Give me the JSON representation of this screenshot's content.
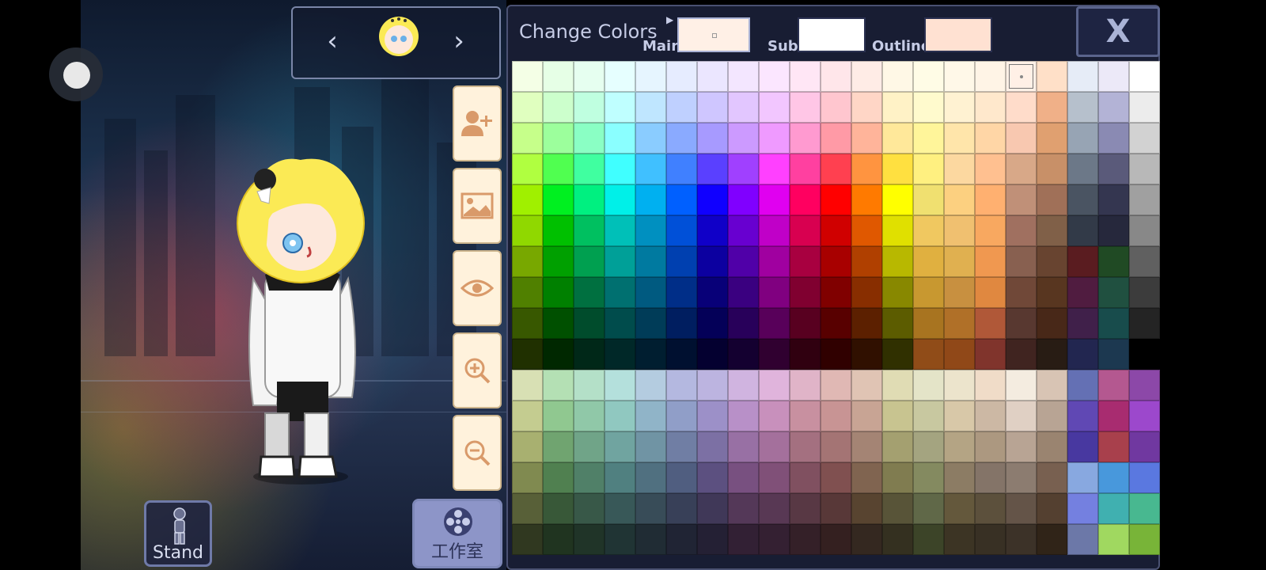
{
  "screen": {
    "accent": "#8d95c8"
  },
  "left_panel": {
    "stand_label": "Stand",
    "studio_label": "工作室",
    "side_buttons": [
      {
        "icon": "add-person-icon"
      },
      {
        "icon": "background-image-icon"
      },
      {
        "icon": "eye-icon"
      },
      {
        "icon": "zoom-in-icon"
      },
      {
        "icon": "zoom-out-icon"
      }
    ],
    "nav": {
      "prev": "‹",
      "next": "›"
    }
  },
  "color_panel": {
    "title": "Change Colors",
    "main_label": "Main",
    "sub_label": "Sub",
    "outline_label": "Outline",
    "main_color": "#fff0e6",
    "sub_color": "#ffffff",
    "outline_color": "#ffe1d2",
    "close_label": "X",
    "selected_cell": [
      0,
      16
    ],
    "palette": [
      [
        "#f4ffe6",
        "#e6ffe6",
        "#e6fff0",
        "#e6ffff",
        "#e6f5ff",
        "#e6ecff",
        "#ebe6ff",
        "#f3e6ff",
        "#fbe6ff",
        "#ffe6f5",
        "#ffe6ea",
        "#ffece6",
        "#fff8e6",
        "#fffce6",
        "#fff8e8",
        "#fff4e6",
        "#fff0e6",
        "#ffe0c8",
        "#e6ecf7",
        "#ece9f8",
        "#ffffff"
      ],
      [
        "#e0ffbf",
        "#ccffcc",
        "#bfffe0",
        "#bfffff",
        "#bfe6ff",
        "#bfd0ff",
        "#cfc6ff",
        "#e2c6ff",
        "#f2c6ff",
        "#ffc6e6",
        "#ffc6cf",
        "#ffd6c6",
        "#fff2c6",
        "#fffacd",
        "#fff2d2",
        "#ffe8cc",
        "#ffdcca",
        "#f0b088",
        "#b6c0cc",
        "#b3b3d6",
        "#ececec"
      ],
      [
        "#c6ff8a",
        "#9cff9c",
        "#8affc4",
        "#8affff",
        "#8accff",
        "#8aaaff",
        "#a79aff",
        "#cc9aff",
        "#ef9aff",
        "#ff9ad0",
        "#ff9aa6",
        "#ffb49a",
        "#ffe89a",
        "#fff59a",
        "#ffe5aa",
        "#ffd6a6",
        "#f8c8b0",
        "#e0a070",
        "#97a4b4",
        "#8a8ab3",
        "#d2d2d2"
      ],
      [
        "#b0ff40",
        "#50ff50",
        "#40ffa0",
        "#40ffff",
        "#40c0ff",
        "#4080ff",
        "#5a40ff",
        "#a040ff",
        "#ff40ff",
        "#ff40a0",
        "#ff4050",
        "#ff9440",
        "#ffe040",
        "#fff080",
        "#fcd8a0",
        "#ffc090",
        "#d8a888",
        "#c89068",
        "#6c7888",
        "#5a5a7a",
        "#b8b8b8"
      ],
      [
        "#a0f000",
        "#00f020",
        "#00f080",
        "#00f0e8",
        "#00b0f0",
        "#0060ff",
        "#1000ff",
        "#8000ff",
        "#e000f0",
        "#ff0060",
        "#ff0000",
        "#ff7a00",
        "#ffff00",
        "#f0e070",
        "#fcd080",
        "#ffb070",
        "#c09078",
        "#a07058",
        "#4a5462",
        "#343650",
        "#a0a0a0"
      ],
      [
        "#90d800",
        "#00c000",
        "#00c060",
        "#00c0b8",
        "#0090c0",
        "#0050d8",
        "#1000c8",
        "#6800d0",
        "#c000c8",
        "#d80050",
        "#d00000",
        "#e05800",
        "#e0e000",
        "#f0c860",
        "#f0c070",
        "#f8a860",
        "#a07060",
        "#806048",
        "#323a48",
        "#26283c",
        "#888888"
      ],
      [
        "#78a800",
        "#00a000",
        "#00a050",
        "#00a098",
        "#007aa0",
        "#0040b0",
        "#0c00a0",
        "#5000a8",
        "#a000a0",
        "#a80040",
        "#a80000",
        "#b04000",
        "#b8b800",
        "#e0b040",
        "#e0b050",
        "#f09850",
        "#886050",
        "#684430",
        "#5a1c20",
        "#204a24",
        "#606060"
      ],
      [
        "#508000",
        "#008000",
        "#007040",
        "#007070",
        "#005a80",
        "#002e88",
        "#080078",
        "#3a0080",
        "#800080",
        "#800030",
        "#800000",
        "#882e00",
        "#888800",
        "#c89830",
        "#c89040",
        "#e08840",
        "#704838",
        "#583620",
        "#501c40",
        "#205040",
        "#3c3c3c"
      ],
      [
        "#385800",
        "#005000",
        "#004c2c",
        "#004c4c",
        "#003c58",
        "#001e60",
        "#040058",
        "#28005a",
        "#58005a",
        "#580020",
        "#580000",
        "#5c2000",
        "#5c5c00",
        "#a87420",
        "#b07028",
        "#b05838",
        "#583830",
        "#482818",
        "#40204a",
        "#184c4c",
        "#242424"
      ],
      [
        "#203000",
        "#002800",
        "#002818",
        "#002828",
        "#001e30",
        "#001030",
        "#040030",
        "#140030",
        "#300030",
        "#300010",
        "#300000",
        "#301000",
        "#303000",
        "#904c18",
        "#904818",
        "#80342c",
        "#402420",
        "#281c14",
        "#222650",
        "#1c3850",
        "#000000"
      ],
      [
        "#d8e0b4",
        "#b4e0b4",
        "#b4e0c8",
        "#b4e0dc",
        "#b4cce0",
        "#b4b8e0",
        "#bcb4e0",
        "#d0b4e0",
        "#e0b4dc",
        "#e0b4c8",
        "#e0b8b4",
        "#e0c4b4",
        "#e0dcb4",
        "#e4e4c8",
        "#ece4cc",
        "#f0dcc8",
        "#f4ece0",
        "#d8c4b4",
        "#6470b4",
        "#b45890",
        "#8c48a8"
      ],
      [
        "#c4cc90",
        "#90c890",
        "#90c8a8",
        "#90c8c0",
        "#90b4c8",
        "#909ec8",
        "#9c90c8",
        "#b890c8",
        "#c890bc",
        "#c890a0",
        "#c89494",
        "#c8a494",
        "#c8c490",
        "#c8c8a0",
        "#d8c8a8",
        "#ccb8a4",
        "#e0d0c4",
        "#b8a494",
        "#6048b4",
        "#a82c70",
        "#9c48cc"
      ],
      [
        "#a8b070",
        "#70a470",
        "#70a488",
        "#70a4a0",
        "#7094a4",
        "#707ea4",
        "#7c70a4",
        "#9870a4",
        "#a4709c",
        "#a47080",
        "#a47474",
        "#a48474",
        "#a4a070",
        "#a4a480",
        "#b4a484",
        "#ac9880",
        "#b8a494",
        "#9a8470",
        "#4838a0",
        "#a8404c",
        "#7038a0"
      ],
      [
        "#808a50",
        "#508050",
        "#508068",
        "#508080",
        "#507080",
        "#505e80",
        "#5c5080",
        "#785080",
        "#805078",
        "#805060",
        "#805050",
        "#806450",
        "#807c50",
        "#848a60",
        "#8c7c64",
        "#847468",
        "#8c7c70",
        "#786050",
        "#88a8e0",
        "#4898dc",
        "#5a78e0"
      ],
      [
        "#586038",
        "#385838",
        "#385848",
        "#385858",
        "#384c58",
        "#384058",
        "#403858",
        "#543858",
        "#583854",
        "#583844",
        "#583838",
        "#584430",
        "#585438",
        "#606848",
        "#64583c",
        "#5c503c",
        "#645448",
        "#544030",
        "#7480e0",
        "#40b0b0",
        "#48b890"
      ],
      [
        "#303820",
        "#203420",
        "#203428",
        "#203434",
        "#202c34",
        "#202434",
        "#242034",
        "#322034",
        "#342032",
        "#342028",
        "#342020",
        "#342820",
        "#343020",
        "#3c4428",
        "#3c3424",
        "#383024",
        "#3c3228",
        "#302418",
        "#6c78a8",
        "#a0d860",
        "#78b438"
      ]
    ]
  }
}
